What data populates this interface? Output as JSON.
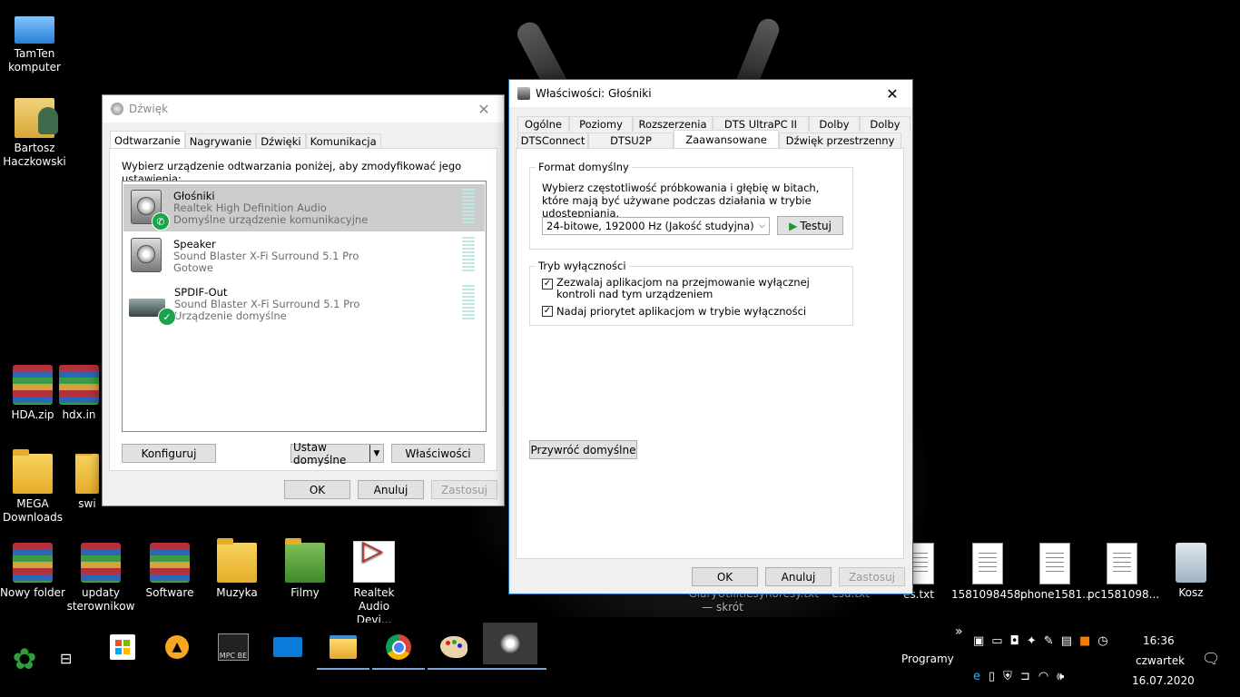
{
  "desktop": {
    "icons": [
      {
        "label": "TamTen komputer",
        "icon": "computer-icon"
      },
      {
        "label": "Bartosz Haczkowski",
        "icon": "user-folder-icon"
      },
      {
        "label": "HDA.zip",
        "icon": "archive-icon"
      },
      {
        "label": "hdx.in",
        "icon": "archive-icon"
      },
      {
        "label": "MEGA Downloads",
        "icon": "folder-icon"
      },
      {
        "label": "swi",
        "icon": "folder-icon"
      },
      {
        "label": "Nowy folder",
        "icon": "archive-folder-icon"
      },
      {
        "label": "updaty sterownikow",
        "icon": "archive-folder-icon"
      },
      {
        "label": "Software",
        "icon": "archive-folder-icon"
      },
      {
        "label": "Muzyka",
        "icon": "music-folder-icon"
      },
      {
        "label": "Filmy",
        "icon": "video-folder-icon"
      },
      {
        "label": "Realtek Audio Devi...",
        "icon": "realtek-icon"
      },
      {
        "label": "GlaryUtiliti... — skrót",
        "icon": "shortcut-icon"
      },
      {
        "label": "esyhoresy.txt",
        "icon": "text-file-icon"
      },
      {
        "label": "esu.txt",
        "icon": "text-file-icon"
      },
      {
        "label": "es.txt",
        "icon": "text-file-icon"
      },
      {
        "label": "1581098458...",
        "icon": "text-file-icon"
      },
      {
        "label": "phone1581...",
        "icon": "text-file-icon"
      },
      {
        "label": "pc1581098...",
        "icon": "text-file-icon"
      },
      {
        "label": "Kosz",
        "icon": "recycle-bin-icon"
      }
    ]
  },
  "sound_dialog": {
    "title": "Dźwięk",
    "tabs": [
      "Odtwarzanie",
      "Nagrywanie",
      "Dźwięki",
      "Komunikacja"
    ],
    "active_tab": "Odtwarzanie",
    "instruction": "Wybierz urządzenie odtwarzania poniżej, aby zmodyfikować jego ustawienia:",
    "devices": [
      {
        "name": "Głośniki",
        "driver": "Realtek High Definition Audio",
        "status": "Domyślne urządzenie komunikacyjne",
        "badge": "phone"
      },
      {
        "name": "Speaker",
        "driver": "Sound Blaster X-Fi Surround 5.1 Pro",
        "status": "Gotowe",
        "badge": ""
      },
      {
        "name": "SPDIF-Out",
        "driver": "Sound Blaster X-Fi Surround 5.1 Pro",
        "status": "Urządzenie domyślne",
        "badge": "check"
      }
    ],
    "configure": "Konfiguruj",
    "set_default": "Ustaw domyślne",
    "properties": "Właściwości",
    "ok": "OK",
    "cancel": "Anuluj",
    "apply": "Zastosuj"
  },
  "props_dialog": {
    "title": "Właściwości: Głośniki",
    "tabs_row1": [
      "Ogólne",
      "Poziomy",
      "Rozszerzenia",
      "DTS UltraPC II",
      "Dolby",
      "Dolby"
    ],
    "tabs_row2": [
      "DTSConnect",
      "DTSU2P",
      "Zaawansowane",
      "Dźwięk przestrzenny"
    ],
    "active_tab": "Zaawansowane",
    "format_group": "Format domyślny",
    "format_desc": "Wybierz częstotliwość próbkowania i głębię w bitach, które mają być używane podczas działania w trybie udostępniania.",
    "format_value": "24-bitowe, 192000 Hz (Jakość studyjna)",
    "test": "Testuj",
    "exclusive_group": "Tryb wyłączności",
    "exclusive_allow": "Zezwalaj aplikacjom na przejmowanie wyłącznej kontroli nad tym urządzeniem",
    "exclusive_priority": "Nadaj priorytet aplikacjom w trybie wyłączności",
    "restore": "Przywróć domyślne",
    "ok": "OK",
    "cancel": "Anuluj",
    "apply": "Zastosuj"
  },
  "taskbar": {
    "apps": [
      "windows-store-icon",
      "vlc-icon",
      "mpc-be-icon",
      "mail-icon",
      "file-explorer-icon",
      "chrome-icon",
      "paint-icon",
      "sound-icon"
    ],
    "programs_label": "Programy",
    "expand": "»",
    "time": "16:36",
    "day": "czwartek",
    "date": "16.07.2020"
  }
}
